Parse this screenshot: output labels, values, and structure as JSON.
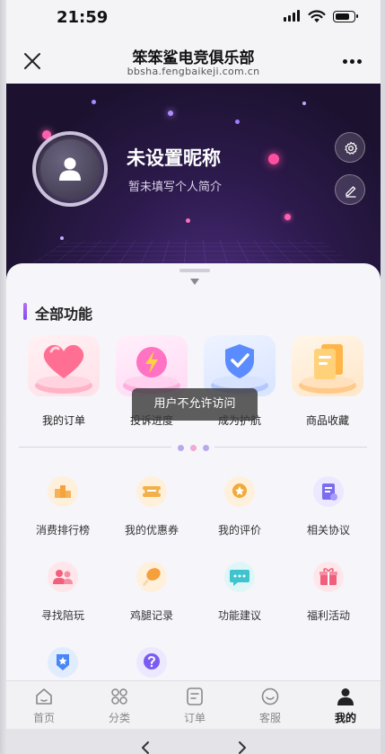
{
  "status_bar": {
    "time": "21:59"
  },
  "nav": {
    "title": "笨笨鲨电竞俱乐部",
    "subtitle": "bbsha.fengbaikeji.com.cn"
  },
  "profile": {
    "nickname": "未设置昵称",
    "bio": "暂未填写个人简介"
  },
  "section": {
    "title": "全部功能"
  },
  "feature_tiles": [
    {
      "label": "我的订单",
      "icon": "heart-icon"
    },
    {
      "label": "投诉进度",
      "icon": "lightning-icon"
    },
    {
      "label": "成为护航",
      "icon": "shield-check-icon"
    },
    {
      "label": "商品收藏",
      "icon": "document-stack-icon"
    }
  ],
  "grid_items": [
    {
      "label": "消费排行榜",
      "icon": "podium-icon"
    },
    {
      "label": "我的优惠券",
      "icon": "coupon-icon"
    },
    {
      "label": "我的评价",
      "icon": "review-icon"
    },
    {
      "label": "相关协议",
      "icon": "agreement-icon"
    },
    {
      "label": "寻找陪玩",
      "icon": "people-icon"
    },
    {
      "label": "鸡腿记录",
      "icon": "drumstick-icon"
    },
    {
      "label": "功能建议",
      "icon": "chat-bubble-icon"
    },
    {
      "label": "福利活动",
      "icon": "gift-icon"
    },
    {
      "label": "",
      "icon": "star-badge-icon"
    },
    {
      "label": "",
      "icon": "question-icon"
    }
  ],
  "toast": {
    "message": "用户不允许访问"
  },
  "tabs": [
    {
      "label": "首页",
      "icon": "home-icon",
      "active": false
    },
    {
      "label": "分类",
      "icon": "category-icon",
      "active": false
    },
    {
      "label": "订单",
      "icon": "order-icon",
      "active": false
    },
    {
      "label": "客服",
      "icon": "service-icon",
      "active": false
    },
    {
      "label": "我的",
      "icon": "user-icon",
      "active": true
    }
  ],
  "colors": {
    "accent": "#8b5cf6",
    "hero_bg": "#241638",
    "sheet_bg": "#f6f5fa"
  }
}
